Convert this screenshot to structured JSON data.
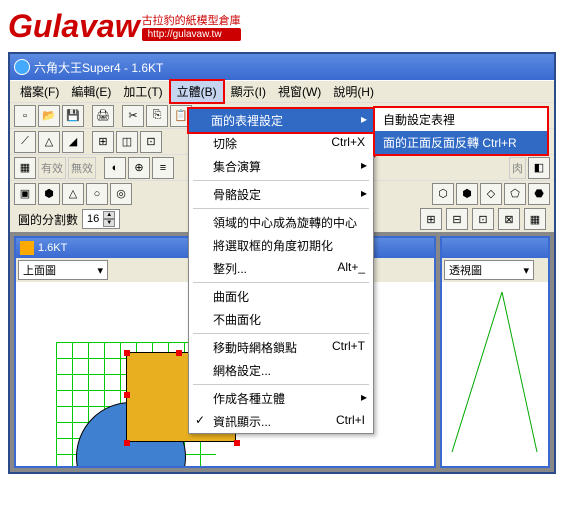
{
  "logo": {
    "brand": "Gulavaw",
    "tagline": "古拉豹的紙模型倉庫",
    "url": "http://gulavaw.tw"
  },
  "window": {
    "title": "六角大王Super4 - 1.6KT"
  },
  "menubar": {
    "items": [
      "檔案(F)",
      "編輯(E)",
      "加工(T)",
      "立體(B)",
      "顯示(I)",
      "視窗(W)",
      "說明(H)"
    ]
  },
  "toolbar2_labels": {
    "valid": "有效",
    "invalid": "無效",
    "flesh": "肉"
  },
  "segment_control": {
    "label": "圓的分割數",
    "value": "16"
  },
  "dropdown": {
    "items": [
      {
        "label": "面的表裡設定",
        "shortcut": "",
        "submenu": true,
        "highlight": true
      },
      {
        "label": "切除",
        "shortcut": "Ctrl+X"
      },
      {
        "label": "集合演算",
        "shortcut": "",
        "submenu": true
      },
      {
        "sep": true
      },
      {
        "label": "骨骼設定",
        "shortcut": "",
        "submenu": true
      },
      {
        "sep": true
      },
      {
        "label": "領域的中心成為旋轉的中心"
      },
      {
        "label": "將選取框的角度初期化"
      },
      {
        "label": "整列...",
        "shortcut": "Alt+_"
      },
      {
        "sep": true
      },
      {
        "label": "曲面化"
      },
      {
        "label": "不曲面化"
      },
      {
        "sep": true
      },
      {
        "label": "移動時網格鎖點",
        "shortcut": "Ctrl+T"
      },
      {
        "label": "網格設定..."
      },
      {
        "sep": true
      },
      {
        "label": "作成各種立體",
        "shortcut": "",
        "submenu": true
      },
      {
        "label": "資訊顯示...",
        "shortcut": "Ctrl+I",
        "check": true
      }
    ]
  },
  "submenu": {
    "items": [
      {
        "label": "自動設定表裡"
      },
      {
        "label": "面的正面反面反轉 Ctrl+R",
        "selected": true
      }
    ]
  },
  "panels": {
    "left": {
      "doc": "1.6KT",
      "view": "上面圖"
    },
    "right": {
      "view": "透視圖"
    }
  }
}
